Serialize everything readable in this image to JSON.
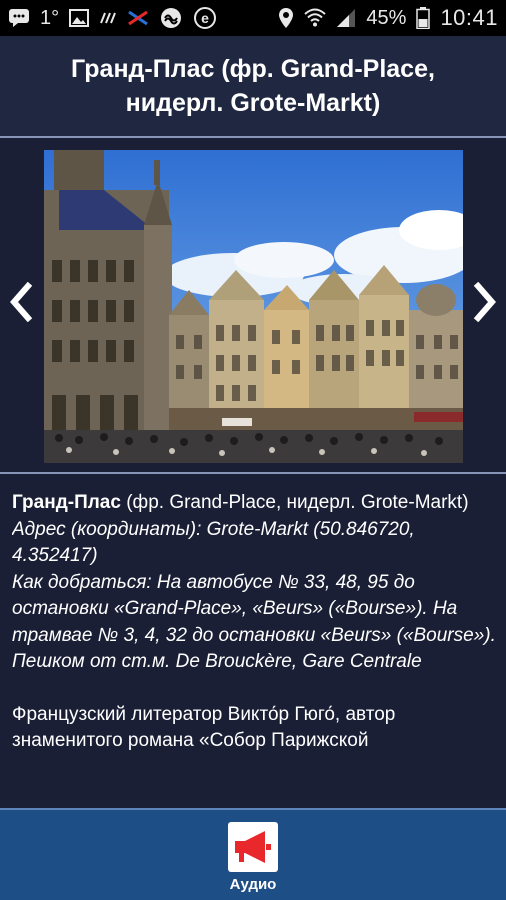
{
  "status_bar": {
    "temperature": "1°",
    "battery": "45%",
    "time": "10:41",
    "icons_left": [
      "message-icon",
      "image-icon",
      "signal-bars-icon",
      "airline-logo-icon",
      "vpn-icon",
      "e-icon"
    ],
    "icons_right": [
      "location-icon",
      "wifi-icon",
      "cell-signal-icon",
      "battery-icon"
    ]
  },
  "header": {
    "title": "Гранд-Плас (фр. Grand-Place, нидерл. Grote-Markt)"
  },
  "gallery": {
    "prev_icon": "chevron-left-icon",
    "next_icon": "chevron-right-icon",
    "photo_subject": "grand-place-buildings-photo"
  },
  "description": {
    "name_bold": "Гранд-Плас",
    "name_rest": " (фр. Grand-Place, нидерл. Grote-Markt)",
    "address": "Адрес (координаты): Grote-Markt (50.846720, 4.352417)",
    "directions": "Как добраться: На автобусе № 33, 48, 95 до остановки «Grand-Place», «Beurs» («Bourse»). На трамвае № 3, 4, 32 до остановки «Beurs» («Bourse»). Пешком от ст.м. De Brouckère, Gare Centrale",
    "paragraph2": "Французский литератор Викто́р Гюго́, автор знаменитого романа «Собор Парижской"
  },
  "bottom_bar": {
    "audio_label": "Аудио",
    "audio_icon": "megaphone-icon",
    "colors": {
      "bar": "#1e4e86",
      "icon": "#e8282b"
    }
  }
}
